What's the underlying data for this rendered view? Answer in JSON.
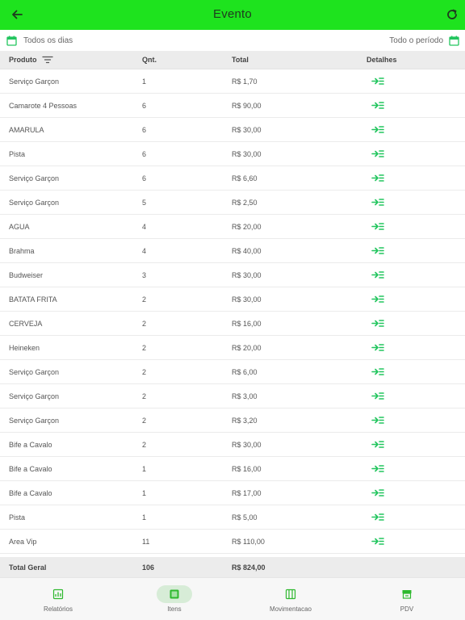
{
  "colors": {
    "accent": "#1ee31e",
    "detail_icon": "#22c55e",
    "calendar_icon": "#22c55e"
  },
  "header": {
    "title": "Evento",
    "back_icon": "arrow-left-icon",
    "refresh_icon": "refresh-icon"
  },
  "filters": {
    "left_label": "Todos os dias",
    "right_label": "Todo o período"
  },
  "table": {
    "columns": [
      "Produto",
      "Qnt.",
      "Total",
      "Detalhes"
    ],
    "rows": [
      {
        "produto": "Serviço Garçon",
        "qnt": "1",
        "total": "R$ 1,70"
      },
      {
        "produto": "Camarote 4 Pessoas",
        "qnt": "6",
        "total": "R$ 90,00"
      },
      {
        "produto": "AMARULA",
        "qnt": "6",
        "total": "R$ 30,00"
      },
      {
        "produto": "Pista",
        "qnt": "6",
        "total": "R$ 30,00"
      },
      {
        "produto": "Serviço Garçon",
        "qnt": "6",
        "total": "R$ 6,60"
      },
      {
        "produto": "Serviço Garçon",
        "qnt": "5",
        "total": "R$ 2,50"
      },
      {
        "produto": "AGUA",
        "qnt": "4",
        "total": "R$ 20,00"
      },
      {
        "produto": "Brahma",
        "qnt": "4",
        "total": "R$ 40,00"
      },
      {
        "produto": "Budweiser",
        "qnt": "3",
        "total": "R$ 30,00"
      },
      {
        "produto": "BATATA FRITA",
        "qnt": "2",
        "total": "R$ 30,00"
      },
      {
        "produto": "CERVEJA",
        "qnt": "2",
        "total": "R$ 16,00"
      },
      {
        "produto": "Heineken",
        "qnt": "2",
        "total": "R$ 20,00"
      },
      {
        "produto": "Serviço Garçon",
        "qnt": "2",
        "total": "R$ 6,00"
      },
      {
        "produto": "Serviço Garçon",
        "qnt": "2",
        "total": "R$ 3,00"
      },
      {
        "produto": "Serviço Garçon",
        "qnt": "2",
        "total": "R$ 3,20"
      },
      {
        "produto": "Bife a Cavalo",
        "qnt": "2",
        "total": "R$ 30,00"
      },
      {
        "produto": "Bife a Cavalo",
        "qnt": "1",
        "total": "R$ 16,00"
      },
      {
        "produto": "Bife a Cavalo",
        "qnt": "1",
        "total": "R$ 17,00"
      },
      {
        "produto": "Pista",
        "qnt": "1",
        "total": "R$ 5,00"
      },
      {
        "produto": "Area Vip",
        "qnt": "11",
        "total": "R$ 110,00"
      }
    ],
    "footer": {
      "label": "Total Geral",
      "qnt": "106",
      "total": "R$ 824,00"
    }
  },
  "bottom_nav": [
    {
      "label": "Relatórios",
      "icon": "report-icon",
      "active": false
    },
    {
      "label": "Itens",
      "icon": "items-icon",
      "active": true
    },
    {
      "label": "Movimentacao",
      "icon": "movement-icon",
      "active": false
    },
    {
      "label": "PDV",
      "icon": "pos-icon",
      "active": false
    }
  ]
}
